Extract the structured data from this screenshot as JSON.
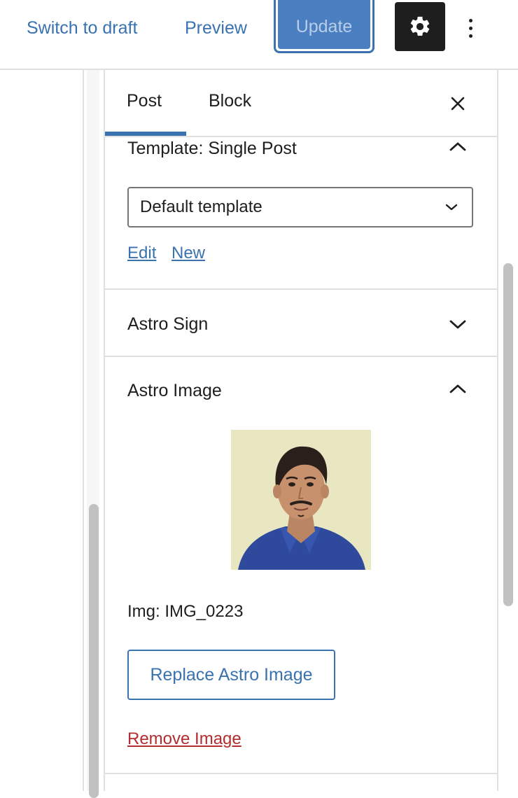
{
  "toolbar": {
    "switch_to_draft": "Switch to draft",
    "preview": "Preview",
    "update": "Update",
    "settings_icon": "gear-icon",
    "options_icon": "kebab-menu-icon"
  },
  "sidebar": {
    "tabs": [
      {
        "label": "Post",
        "active": true
      },
      {
        "label": "Block",
        "active": false
      }
    ],
    "close_icon": "close-icon",
    "template_panel": {
      "title": "Template: Single Post",
      "expanded": true,
      "select_value": "Default template",
      "edit_link": "Edit",
      "new_link": "New"
    },
    "astro_sign_panel": {
      "title": "Astro Sign",
      "expanded": false
    },
    "astro_image_panel": {
      "title": "Astro Image",
      "expanded": true,
      "image_label": "Img: IMG_0223",
      "replace_button": "Replace Astro Image",
      "remove_link": "Remove Image"
    }
  },
  "colors": {
    "accent": "#3a72b0",
    "update_bg": "#4a7fc1",
    "danger": "#b32d2e",
    "dark": "#1e1e1e",
    "border": "#e0e0e0"
  }
}
